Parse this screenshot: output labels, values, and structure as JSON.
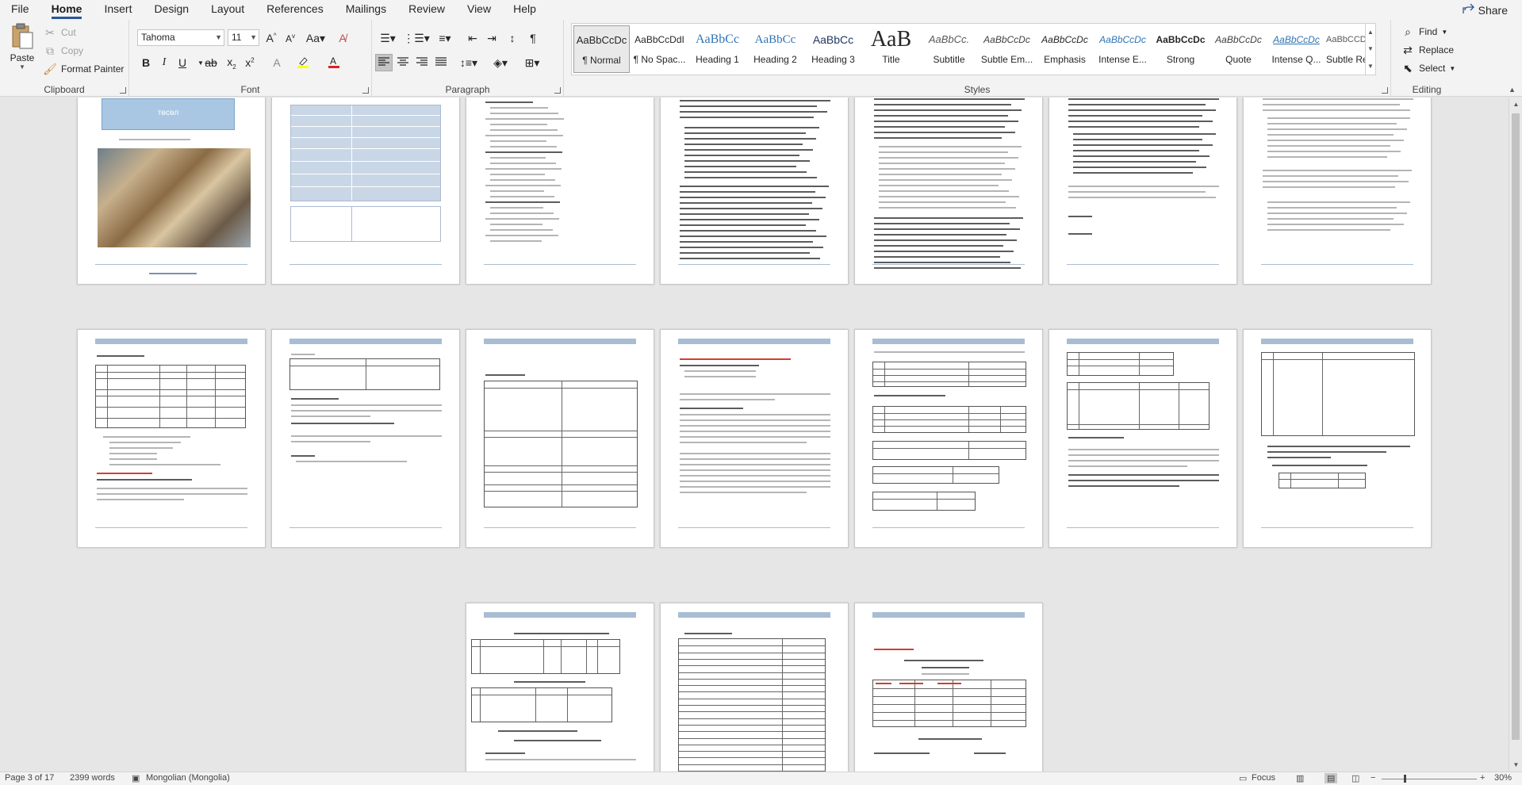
{
  "menu": {
    "tabs": [
      "File",
      "Home",
      "Insert",
      "Design",
      "Layout",
      "References",
      "Mailings",
      "Review",
      "View",
      "Help"
    ],
    "active": "Home",
    "share_label": "Share"
  },
  "ribbon": {
    "clipboard": {
      "label": "Clipboard",
      "paste": "Paste",
      "cut": "Cut",
      "copy": "Copy",
      "format_painter": "Format Painter"
    },
    "font": {
      "label": "Font",
      "font_name": "Tahoma",
      "font_size": "11"
    },
    "paragraph": {
      "label": "Paragraph"
    },
    "styles": {
      "label": "Styles",
      "items": [
        {
          "sample": "AaBbCcDc",
          "name": "¶ Normal",
          "color": "#000000"
        },
        {
          "sample": "AaBbCcDdI",
          "name": "¶ No Spac...",
          "color": "#000000"
        },
        {
          "sample": "AaBbCc",
          "name": "Heading 1",
          "color": "#2e74b5"
        },
        {
          "sample": "AaBbCc",
          "name": "Heading 2",
          "color": "#2e74b5"
        },
        {
          "sample": "AaBbCc",
          "name": "Heading 3",
          "color": "#1f3763"
        },
        {
          "sample": "AaB",
          "name": "Title",
          "color": "#000000"
        },
        {
          "sample": "AaBbCc.",
          "name": "Subtitle",
          "color": "#595959"
        },
        {
          "sample": "AaBbCcDc",
          "name": "Subtle Em...",
          "color": "#404040"
        },
        {
          "sample": "AaBbCcDc",
          "name": "Emphasis",
          "color": "#000000"
        },
        {
          "sample": "AaBbCcDc",
          "name": "Intense E...",
          "color": "#2e74b5"
        },
        {
          "sample": "AaBbCcDc",
          "name": "Strong",
          "color": "#000000"
        },
        {
          "sample": "AaBbCcDc",
          "name": "Quote",
          "color": "#404040"
        },
        {
          "sample": "AaBbCcDc",
          "name": "Intense Q...",
          "color": "#2e74b5"
        },
        {
          "sample": "AaBbCCDDI",
          "name": "Subtle Ref...",
          "color": "#595959"
        }
      ]
    },
    "editing": {
      "label": "Editing",
      "find": "Find",
      "replace": "Replace",
      "select": "Select"
    }
  },
  "document": {
    "cover_title": "төсөл"
  },
  "status": {
    "page": "Page 3 of 17",
    "words": "2399 words",
    "language": "Mongolian (Mongolia)",
    "focus": "Focus",
    "zoom": "30%"
  }
}
